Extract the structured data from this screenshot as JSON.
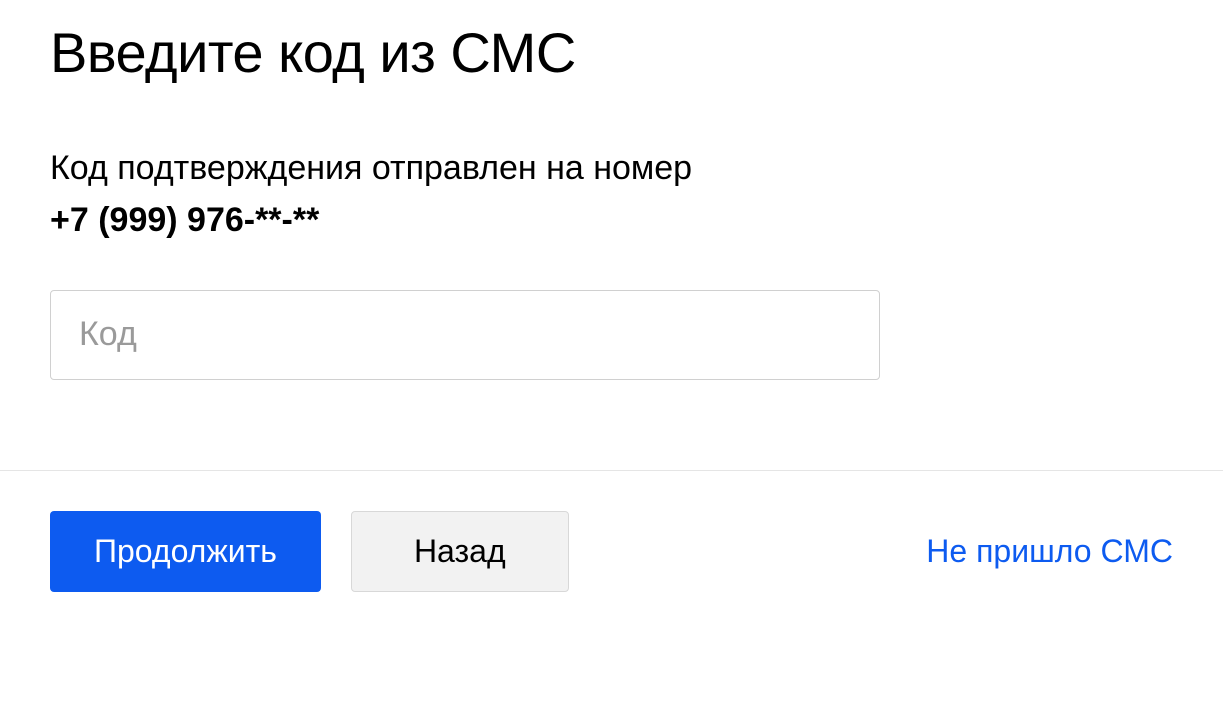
{
  "heading": "Введите код из СМС",
  "description": "Код подтверждения отправлен на номер",
  "phone": "+7 (999) 976-**-**",
  "input": {
    "placeholder": "Код",
    "value": ""
  },
  "buttons": {
    "continue": "Продолжить",
    "back": "Назад"
  },
  "link": "Не пришло СМС"
}
